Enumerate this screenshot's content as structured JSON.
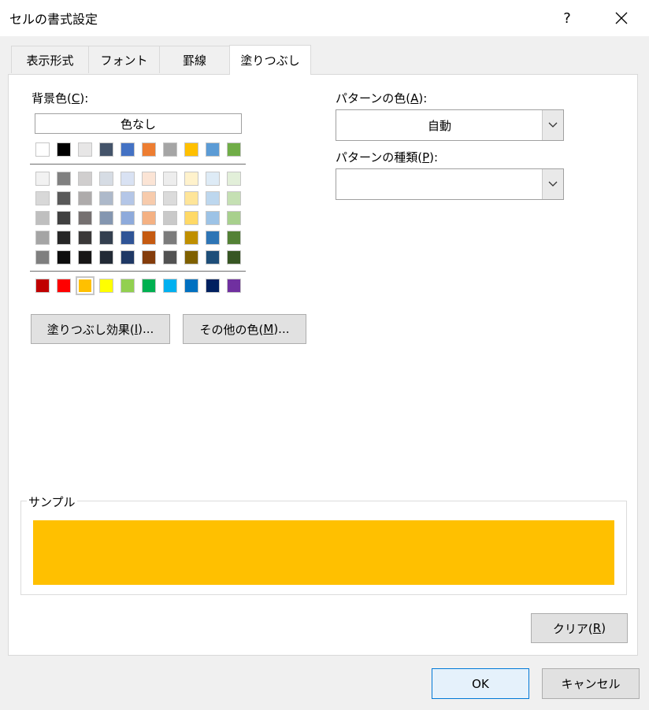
{
  "window": {
    "title": "セルの書式設定",
    "help": "?"
  },
  "tabs": [
    {
      "label": "表示形式"
    },
    {
      "label": "フォント"
    },
    {
      "label": "罫線"
    },
    {
      "label": "塗りつぶし",
      "active": true
    }
  ],
  "background": {
    "label_prefix": "背景色(",
    "label_key": "C",
    "label_suffix": "):",
    "no_color": "色なし",
    "theme_top": [
      "#ffffff",
      "#000000",
      "#e7e6e6",
      "#44546a",
      "#4472c4",
      "#ed7d31",
      "#a5a5a5",
      "#ffc000",
      "#5b9bd5",
      "#70ad47"
    ],
    "theme_shades": [
      [
        "#f2f2f2",
        "#808080",
        "#d0cece",
        "#d6dce4",
        "#d9e2f3",
        "#fbe4d5",
        "#ededed",
        "#fff2cc",
        "#deebf6",
        "#e2efd9"
      ],
      [
        "#d8d8d8",
        "#595959",
        "#aeabab",
        "#adb9ca",
        "#b4c6e7",
        "#f7cbac",
        "#dbdbdb",
        "#fee599",
        "#bdd7ee",
        "#c5e0b3"
      ],
      [
        "#bfbfbf",
        "#404040",
        "#757070",
        "#8496b0",
        "#8eaadb",
        "#f4b183",
        "#c9c9c9",
        "#ffd966",
        "#9dc3e6",
        "#a8d08d"
      ],
      [
        "#a5a5a5",
        "#262626",
        "#3a3838",
        "#333f4f",
        "#2f5496",
        "#c55a11",
        "#7b7b7b",
        "#bf8f00",
        "#2e75b5",
        "#538135"
      ],
      [
        "#7f7f7f",
        "#0d0d0d",
        "#171616",
        "#222a35",
        "#1f3864",
        "#843c0b",
        "#525252",
        "#7f6000",
        "#1e4e79",
        "#375623"
      ]
    ],
    "standard": [
      "#c00000",
      "#ff0000",
      "#ffc000",
      "#ffff00",
      "#92d050",
      "#00b050",
      "#00b0f0",
      "#0070c0",
      "#002060",
      "#7030a0"
    ],
    "selected_standard_index": 2
  },
  "buttons": {
    "fill_effects_prefix": "塗りつぶし効果(",
    "fill_effects_key": "I",
    "fill_effects_suffix": ")...",
    "more_colors_prefix": "その他の色(",
    "more_colors_key": "M",
    "more_colors_suffix": ")...",
    "clear_prefix": "クリア(",
    "clear_key": "R",
    "clear_suffix": ")",
    "ok": "OK",
    "cancel": "キャンセル"
  },
  "pattern": {
    "color_label_prefix": "パターンの色(",
    "color_label_key": "A",
    "color_label_suffix": "):",
    "color_value": "自動",
    "style_label_prefix": "パターンの種類(",
    "style_label_key": "P",
    "style_label_suffix": "):",
    "style_value": ""
  },
  "sample": {
    "label": "サンプル",
    "color": "#ffc000"
  }
}
